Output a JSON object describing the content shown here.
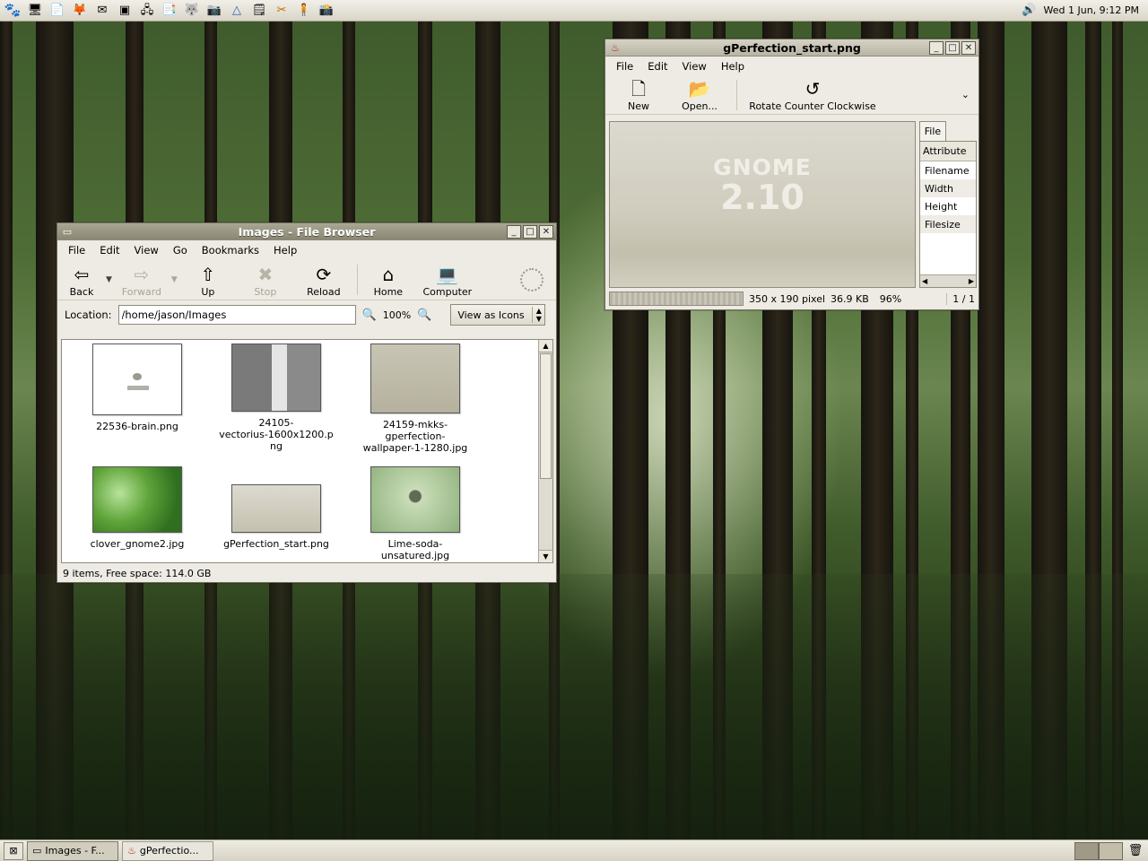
{
  "top_panel": {
    "launchers": [
      {
        "icon": "gnome-foot-icon",
        "glyph": "🐾"
      },
      {
        "icon": "computer-icon",
        "glyph": "🖥"
      },
      {
        "icon": "text-editor-icon",
        "glyph": "📄"
      },
      {
        "icon": "firefox-icon",
        "glyph": "🦊"
      },
      {
        "icon": "mail-icon",
        "glyph": "✉"
      },
      {
        "icon": "terminal-icon",
        "glyph": "▣"
      },
      {
        "icon": "network-icon",
        "glyph": "🖧"
      },
      {
        "icon": "documents-icon",
        "glyph": "📑"
      },
      {
        "icon": "gimp-icon",
        "glyph": "🐺"
      },
      {
        "icon": "camera-icon",
        "glyph": "📷"
      },
      {
        "icon": "launch-icon",
        "glyph": "△"
      },
      {
        "icon": "notepad-icon",
        "glyph": "🗒"
      },
      {
        "icon": "tools-icon",
        "glyph": "✂"
      },
      {
        "icon": "person-icon",
        "glyph": "🧍"
      },
      {
        "icon": "webcam-icon",
        "glyph": "📸"
      }
    ],
    "clock": "Wed  1 Jun,  9:12 PM"
  },
  "file_browser": {
    "title": "Images - File Browser",
    "menu": [
      "File",
      "Edit",
      "View",
      "Go",
      "Bookmarks",
      "Help"
    ],
    "toolbar": {
      "back": "Back",
      "forward": "Forward",
      "up": "Up",
      "stop": "Stop",
      "reload": "Reload",
      "home": "Home",
      "computer": "Computer"
    },
    "location_label": "Location:",
    "location_value": "/home/jason/Images",
    "zoom": "100%",
    "view_mode": "View as Icons",
    "files": [
      {
        "name": "22536-brain.png",
        "lines": [
          "22536-brain.png"
        ]
      },
      {
        "name": "24105-vectorius-1600x1200.png",
        "lines": [
          "24105-",
          "vectorius-1600x1200.p",
          "ng"
        ]
      },
      {
        "name": "24159-mkks-gperfection-wallpaper-1-1280.jpg",
        "lines": [
          "24159-mkks-",
          "gperfection-",
          "wallpaper-1-1280.jpg"
        ]
      },
      {
        "name": "clover_gnome2.jpg",
        "lines": [
          "clover_gnome2.jpg"
        ]
      },
      {
        "name": "gPerfection_start.png",
        "lines": [
          "gPerfection_start.png"
        ]
      },
      {
        "name": "Lime-soda-unsatured.jpg",
        "lines": [
          "Lime-soda-",
          "unsatured.jpg"
        ]
      }
    ],
    "status": "9 items, Free space: 114.0 GB"
  },
  "image_viewer": {
    "title": "gPerfection_start.png",
    "menu": [
      "File",
      "Edit",
      "View",
      "Help"
    ],
    "toolbar": {
      "new": "New",
      "open": "Open...",
      "rotate": "Rotate Counter Clockwise"
    },
    "image_text": {
      "word": "GNOME",
      "version": "2.10"
    },
    "side_tab": "File",
    "attr_header": "Attribute",
    "attributes": [
      "Filename",
      "Width",
      "Height",
      "Filesize"
    ],
    "status": {
      "dimensions": "350 x 190 pixel",
      "size": "36.9 KB",
      "zoom": "96%",
      "page": "1 / 1"
    }
  },
  "taskbar": {
    "tasks": [
      {
        "label": "Images - F...",
        "icon": "folder-icon"
      },
      {
        "label": "gPerfectio...",
        "icon": "viewer-icon"
      }
    ]
  },
  "colors": {
    "panel": "#d9d5c8",
    "window": "#edebe3",
    "titlebar_focused": "#8a8874"
  }
}
